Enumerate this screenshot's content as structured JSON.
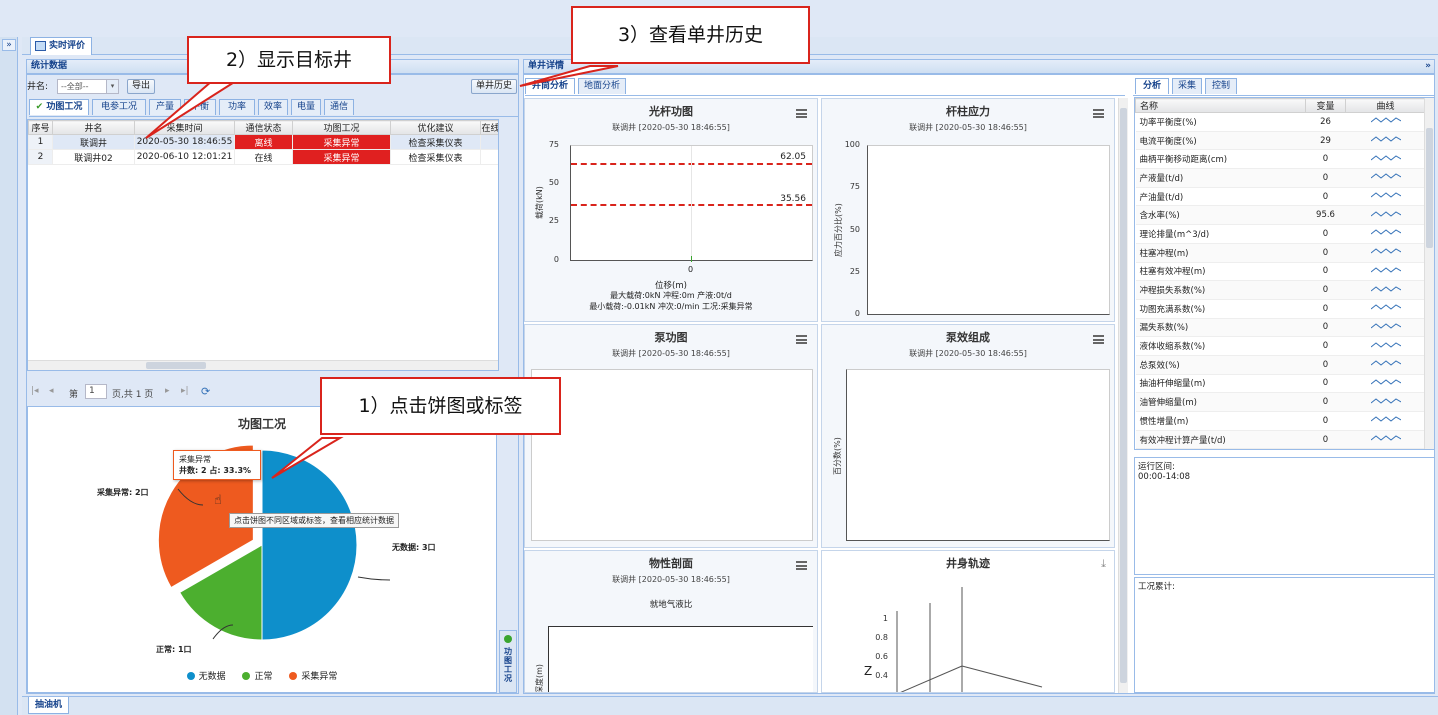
{
  "main_tab": "实时评价",
  "bottom_tab": "抽油机",
  "collapse_symbol": "»",
  "callouts": {
    "step1": "1）点击饼图或标签",
    "step2": "2）显示目标井",
    "step3": "3）查看单井历史"
  },
  "stats_panel": {
    "title": "统计数据",
    "well_label": "井名:",
    "well_select": "--全部--",
    "export_button": "导出",
    "history_button": "单井历史",
    "tabs": [
      "功图工况",
      "电参工况",
      "产量",
      "平衡",
      "功率",
      "效率",
      "电量",
      "通信"
    ],
    "columns": [
      "序号",
      "井名",
      "采集时间",
      "通信状态",
      "功图工况",
      "优化建议",
      "在线"
    ],
    "rows": [
      {
        "no": "1",
        "well": "联调井",
        "time": "2020-05-30 18:46:55",
        "comm": "离线",
        "status": "采集异常",
        "advice": "检查采集仪表"
      },
      {
        "no": "2",
        "well": "联调井02",
        "time": "2020-06-10 12:01:21",
        "comm": "在线",
        "status": "采集异常",
        "advice": "检查采集仪表"
      }
    ],
    "pager": {
      "page_label": "第",
      "page_value": "1",
      "page_total": "页,共 1 页"
    },
    "side_label": "功图工况"
  },
  "pie": {
    "title": "功图工况",
    "tooltip_title": "采集异常",
    "tooltip_body": "井数: 2 占: 33.3%",
    "hint": "点击饼图不同区域或标签，查看相应统计数据",
    "labels": {
      "nodata": "无数据: 3口",
      "normal": "正常: 1口",
      "abnormal": "采集异常: 2口"
    },
    "legend": [
      "无数据",
      "正常",
      "采集异常"
    ],
    "colors": {
      "nodata": "#0e8fcb",
      "normal": "#4caf2f",
      "abnormal": "#ee5a1f"
    }
  },
  "chart_data": [
    {
      "type": "pie",
      "title": "功图工况",
      "categories": [
        "无数据",
        "正常",
        "采集异常"
      ],
      "values": [
        3,
        1,
        2
      ]
    }
  ],
  "detail_panel": {
    "title": "单井详情",
    "tabs": [
      "井筒分析",
      "地面分析"
    ],
    "cards": {
      "c1": {
        "title": "光杆功图",
        "sub": "联调井 [2020-05-30 18:46:55]",
        "ylabel": "载荷(kN)",
        "xlabel": "位移(m)",
        "yticks": [
          "75",
          "50",
          "25",
          "0"
        ],
        "xtick": "0",
        "line1": "62.05",
        "line2": "35.56",
        "info1": "最大载荷:0kN 冲程:0m 产液:0t/d",
        "info2": "最小载荷:-0.01kN 冲次:0/min 工况:采集异常"
      },
      "c2": {
        "title": "杆柱应力",
        "sub": "联调井 [2020-05-30 18:46:55]",
        "ylabel": "应力百分比(%)",
        "yticks": [
          "100",
          "75",
          "50",
          "25",
          "0"
        ]
      },
      "c3": {
        "title": "泵功图",
        "sub": "联调井 [2020-05-30 18:46:55]"
      },
      "c4": {
        "title": "泵效组成",
        "sub": "联调井 [2020-05-30 18:46:55]",
        "ylabel": "百分数(%)"
      },
      "c5": {
        "title": "物性剖面",
        "sub": "联调井 [2020-05-30 18:46:55]",
        "inner": "就地气液比",
        "ylabel": "深度(m)"
      },
      "c6": {
        "title": "井身轨迹",
        "yticks": [
          "1",
          "0.8",
          "0.6",
          "0.4"
        ],
        "zlabel": "Z"
      }
    }
  },
  "right_panel": {
    "tabs": [
      "分析",
      "采集",
      "控制"
    ],
    "columns": [
      "名称",
      "变量",
      "曲线"
    ],
    "rows": [
      {
        "name": "功率平衡度(%)",
        "value": "26"
      },
      {
        "name": "电流平衡度(%)",
        "value": "29"
      },
      {
        "name": "曲柄平衡移动距离(cm)",
        "value": "0"
      },
      {
        "name": "产液量(t/d)",
        "value": "0"
      },
      {
        "name": "产油量(t/d)",
        "value": "0"
      },
      {
        "name": "含水率(%)",
        "value": "95.6"
      },
      {
        "name": "理论排量(m^3/d)",
        "value": "0"
      },
      {
        "name": "柱塞冲程(m)",
        "value": "0"
      },
      {
        "name": "柱塞有效冲程(m)",
        "value": "0"
      },
      {
        "name": "冲程损失系数(%)",
        "value": "0"
      },
      {
        "name": "功图充满系数(%)",
        "value": "0"
      },
      {
        "name": "漏失系数(%)",
        "value": "0"
      },
      {
        "name": "液体收缩系数(%)",
        "value": "0"
      },
      {
        "name": "总泵效(%)",
        "value": "0"
      },
      {
        "name": "抽油杆伸缩量(m)",
        "value": "0"
      },
      {
        "name": "油管伸缩量(m)",
        "value": "0"
      },
      {
        "name": "惯性增量(m)",
        "value": "0"
      },
      {
        "name": "有效冲程计算产量(t/d)",
        "value": "0"
      }
    ],
    "run_label": "运行区间:",
    "run_value": "00:00-14:08",
    "cond_label": "工况累计:"
  }
}
